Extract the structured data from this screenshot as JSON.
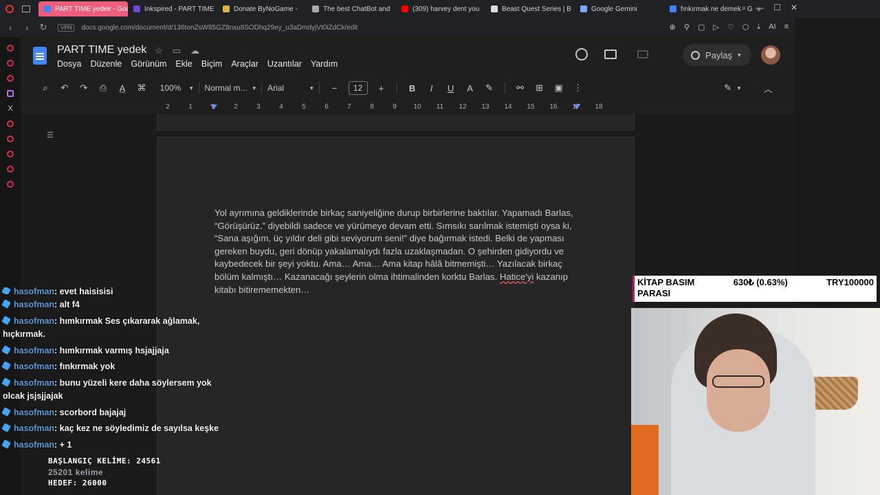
{
  "browser": {
    "tabs": [
      {
        "label": "PART TIME yedek - Google",
        "color": "#4285f4",
        "active": true
      },
      {
        "label": "Inkspired - PART TIME",
        "color": "#6b4bd8"
      },
      {
        "label": "Donate ByNoGame - ",
        "color": "#e0b24c"
      },
      {
        "label": "The best ChatBot and",
        "color": "#aaaaaa"
      },
      {
        "label": "(309) harvey dent you",
        "color": "#ff0000"
      },
      {
        "label": "Beast Quest Series | B",
        "color": "#dddddd"
      },
      {
        "label": "Google Gemini",
        "color": "#7aa8ff"
      },
      {
        "label": "fınkırmak ne demek - G",
        "color": "#4285f4"
      }
    ],
    "new_tab_icon": "plus-icon",
    "url": "docs.google.com/document/d/136tonZsW85GZ8nxu8SODhq29ey_u3aDmdyjVt0iZdCk/edit",
    "vpn_label": "VPN"
  },
  "docs": {
    "title": "PART TIME  yedek",
    "menu": [
      "Dosya",
      "Düzenle",
      "Görünüm",
      "Ekle",
      "Biçim",
      "Araçlar",
      "Uzantılar",
      "Yardım"
    ],
    "share_label": "Paylaş",
    "toolbar": {
      "zoom": "100%",
      "style": "Normal m...",
      "font": "Arial",
      "font_size": "12"
    },
    "ruler_numbers": [
      "2",
      "1",
      "1",
      "2",
      "3",
      "4",
      "5",
      "6",
      "7",
      "8",
      "9",
      "10",
      "11",
      "12",
      "13",
      "14",
      "15",
      "16",
      "17",
      "18"
    ],
    "body_text_before": "Yol ayrımına geldiklerinde birkaç saniyeliğine durup birbirlerine baktılar. Yapamadı Barlas, “Görüşürüz.” diyebildi sadece ve yürümeye devam etti. Sımsıkı sarılmak istemişti oysa ki, “Sana aşığım, üç yıldır deli gibi seviyorum seni!” diye bağırmak istedi. Belki de yapması gereken buydu, geri dönüp yakalamalıydı fazla uzaklaşmadan. O şehirden gidiyordu ve kaybedecek bir şeyi yoktu. Ama… Ama… Ama kitap hâlâ bitmemişti… Yazılacak birkaç bölüm kalmıştı… Kazanacağı şeylerin olma ihtimalinden korktu Barlas. ",
    "body_text_misspelled": "Hatice'yi",
    "body_text_after": " kazanıp kitabı bitirememekten…"
  },
  "chat": {
    "messages": [
      {
        "user": "hasofman",
        "text": ": evet hajsjsjsj",
        "cut": true
      },
      {
        "user": "hasofman",
        "text": ": alt f4"
      },
      {
        "user": "hasofman",
        "text": ": hımkırmak Ses çıkararak ağlamak, hıçkırmak."
      },
      {
        "user": "hasofman",
        "text": ": hımkırmak varmış hsjajjaja"
      },
      {
        "user": "hasofman",
        "text": ": fınkırmak yok"
      },
      {
        "user": "hasofman",
        "text": ": bunu yüzeli kere daha söylersem yok olcak jsjsjjajak"
      },
      {
        "user": "hasofman",
        "text": ": scorbord bajajaj"
      },
      {
        "user": "hasofman",
        "text": ": kaç kez ne söyledimiz de sayılsa keşke"
      },
      {
        "user": "hasofman",
        "text": ": + 1"
      }
    ]
  },
  "word_count": {
    "start_label": "BAŞLANGIÇ KELİME: 24561",
    "current": "25201 kelime",
    "target_label": "HEDEF: 26000"
  },
  "stats_box": {
    "line1_left": "KİTAP BASIM",
    "line1_mid": "630₺ (0.63%)",
    "line1_right": "TRY100000",
    "line2": "PARASI",
    "accent": "#c2185b"
  }
}
